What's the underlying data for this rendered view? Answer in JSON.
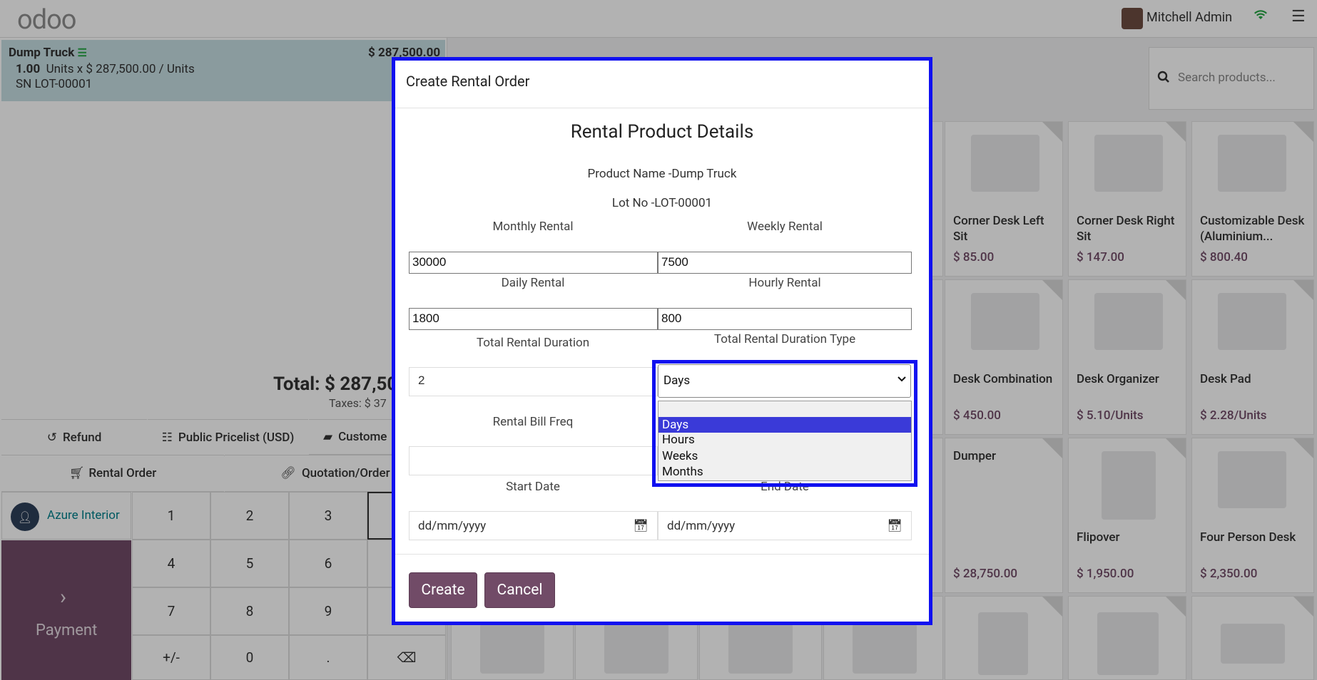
{
  "header": {
    "logo": "odoo",
    "user_name": "Mitchell Admin"
  },
  "order": {
    "line": {
      "name": "Dump Truck",
      "price": "$ 287,500.00",
      "qty": "1.00",
      "qty_detail": "Units x $ 287,500.00 / Units",
      "serial": "SN LOT-00001"
    },
    "total": "Total: $ 287,50",
    "taxes": "Taxes: $ 37"
  },
  "controls": {
    "refund": "Refund",
    "pricelist": "Public Pricelist (USD)",
    "customer_note": "Custome",
    "rental_order": "Rental Order",
    "quotation_order": "Quotation/Order"
  },
  "customer": {
    "name": "Azure Interior"
  },
  "numpad": {
    "keys": [
      "1",
      "2",
      "3",
      "4",
      "5",
      "6",
      "7",
      "8",
      "9",
      "+/-",
      "0",
      "."
    ]
  },
  "payment": {
    "label": "Payment"
  },
  "search": {
    "placeholder": "Search products..."
  },
  "products": [
    {
      "title": "Corner Desk Left Sit",
      "price": "$ 85.00"
    },
    {
      "title": "Corner Desk Right Sit",
      "price": "$ 147.00"
    },
    {
      "title": "Customizable Desk (Aluminium...",
      "price": "$ 800.40"
    },
    {
      "title": "Desk Combination",
      "price": "$ 450.00"
    },
    {
      "title": "Desk Organizer",
      "price": "$ 5.10/Units"
    },
    {
      "title": "Desk Pad",
      "price": "$ 2.28/Units"
    },
    {
      "title": "Dumper",
      "price": "$ 28,750.00"
    },
    {
      "title": "Flipover",
      "price": "$ 1,950.00"
    },
    {
      "title": "Four Person Desk",
      "price": "$ 2,350.00"
    }
  ],
  "modal": {
    "title": "Create Rental Order",
    "heading": "Rental Product Details",
    "product_name": "Product Name -Dump Truck",
    "lot_no": "Lot No -LOT-00001",
    "monthly_label": "Monthly Rental",
    "monthly_value": "30000",
    "weekly_label": "Weekly Rental",
    "weekly_value": "7500",
    "daily_label": "Daily Rental",
    "daily_value": "1800",
    "hourly_label": "Hourly Rental",
    "hourly_value": "800",
    "duration_label": "Total Rental Duration",
    "duration_value": "2",
    "duration_type_label": "Total Rental Duration Type",
    "duration_type_value": "Days",
    "duration_type_options": [
      "Days",
      "Hours",
      "Weeks",
      "Months"
    ],
    "bill_freq_label": "Rental Bill Freq",
    "start_date_label": "Start Date",
    "end_date_label": "End Date",
    "date_placeholder": "dd/mm/yyyy",
    "create_button": "Create",
    "cancel_button": "Cancel"
  }
}
